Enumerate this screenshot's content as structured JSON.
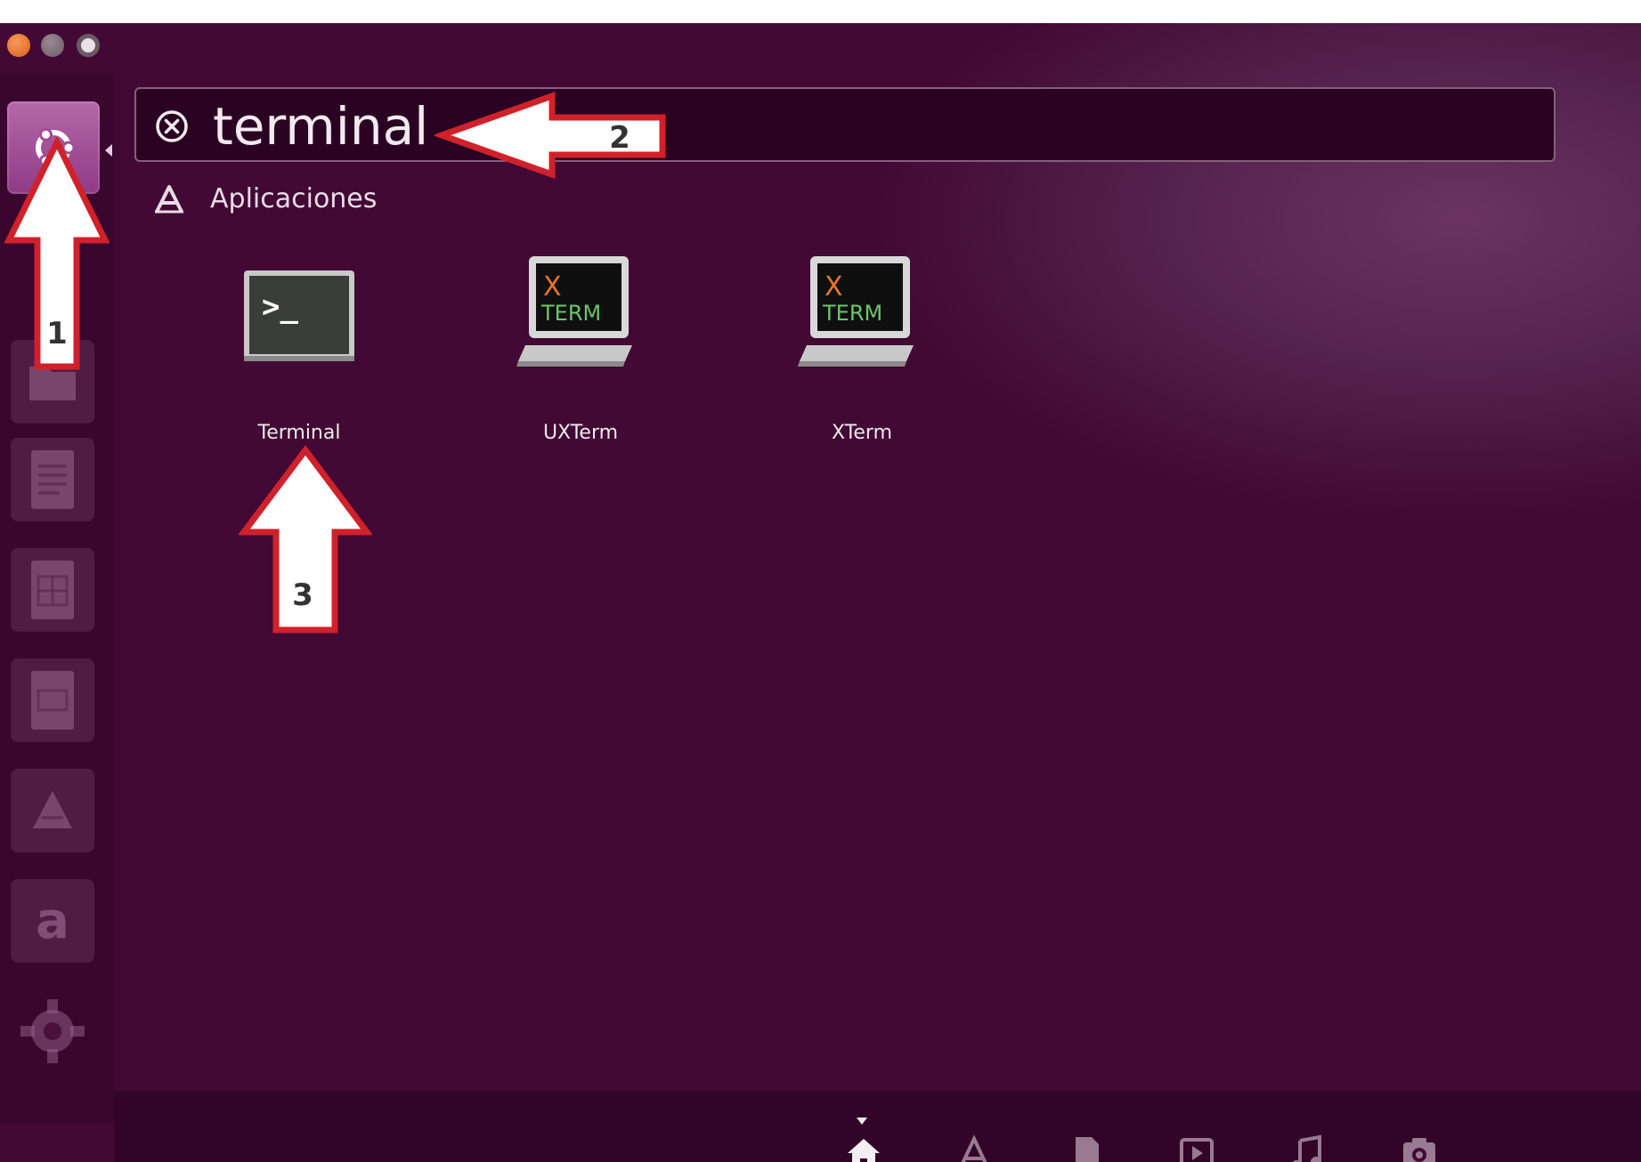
{
  "search": {
    "query": "terminal"
  },
  "category": {
    "label": "Aplicaciones"
  },
  "results": [
    {
      "label": "Terminal",
      "icon": "terminal-app-icon"
    },
    {
      "label": "UXTerm",
      "icon": "xterm-app-icon"
    },
    {
      "label": "XTerm",
      "icon": "xterm-app-icon"
    }
  ],
  "xterm_icon": {
    "line1": "X",
    "line2": "TERM"
  },
  "terminal_icon": {
    "prompt": ">_"
  },
  "annotations": [
    {
      "number": "1"
    },
    {
      "number": "2"
    },
    {
      "number": "3"
    }
  ],
  "launcher": {
    "items": [
      "dash-home-icon",
      "files-icon",
      "libreoffice-writer-icon",
      "libreoffice-calc-icon",
      "libreoffice-impress-icon",
      "software-center-icon",
      "amazon-icon",
      "system-settings-icon"
    ],
    "amazon_glyph": "a"
  },
  "lenses": [
    "home-lens-icon",
    "applications-lens-icon",
    "files-lens-icon",
    "video-lens-icon",
    "music-lens-icon",
    "photos-lens-icon"
  ],
  "colors": {
    "background": "#420935",
    "annotation_fill": "#ffffff",
    "annotation_stroke": "#d0212a",
    "accent_orange": "#e05e1c"
  }
}
